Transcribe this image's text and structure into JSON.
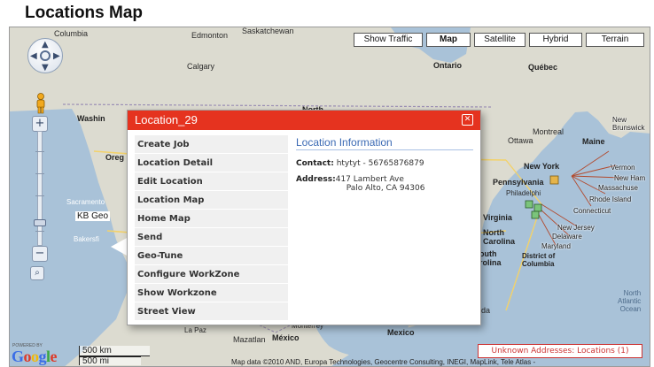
{
  "page": {
    "title": "Locations Map"
  },
  "map": {
    "buttons": {
      "traffic": "Show Traffic",
      "map": "Map",
      "satellite": "Satellite",
      "hybrid": "Hybrid",
      "terrain": "Terrain"
    },
    "labels": {
      "columbia": "Columbia",
      "edmonton": "Edmonton",
      "saskatchewan": "Saskatchewan",
      "calgary": "Calgary",
      "ontario": "Ontario",
      "quebec": "Québec",
      "washington": "Washin",
      "north": "North",
      "oregon": "Oreg",
      "new_brunswick": "New\nBrunswick",
      "maine": "Maine",
      "montreal": "Montreal",
      "ottawa": "Ottawa",
      "new_york": "New York",
      "vermont": "Vermon",
      "new_hampshire": "New Ham",
      "massachusetts": "Massachuse",
      "pennsylvania": "Pennsylvania",
      "philadelphia": "Philadelphi",
      "rhode_island": "Rhode Island",
      "connecticut": "Connecticut",
      "virginia": "Virginia",
      "new_jersey": "New Jersey",
      "delaware": "Delaware",
      "maryland": "Maryland",
      "north_carolina": "North\nCarolina",
      "south_carolina": "outh\nrolina",
      "dc": "District of\nColumbia",
      "ida": "ida",
      "atlantic": "North\nAtlantic\nOcean",
      "sacramento": "Sacramento",
      "kb_geo": "KB Geo",
      "bakersfield": "Bakersfi",
      "mazatlan": "Mazatlan",
      "mexico": "México",
      "mexico2": "Mexico",
      "monterrey": "Monterrey",
      "la_paz": "La Paz"
    },
    "scale": {
      "km": "500 km",
      "mi": "500 mi"
    },
    "logo": {
      "powered": "POWERED BY",
      "text": "Google"
    },
    "attribution": "Map data ©2010 AND, Europa Technologies, Geocentre Consulting, INEGI, MapLink, Tele Atlas -",
    "unknown_addresses": "Unknown Addresses: Locations (1)"
  },
  "popup": {
    "title": "Location_29",
    "close": "✕",
    "menu": [
      "Create Job",
      "Location Detail",
      "Edit Location",
      "Location Map",
      "Home Map",
      "Send",
      "Geo-Tune",
      "Configure WorkZone",
      "Show Workzone",
      "Street View"
    ],
    "info": {
      "heading": "Location Information",
      "contact_label": "Contact:",
      "contact_value": "htytyt - 56765876879",
      "address_label": "Address:",
      "address_line1": "417 Lambert Ave",
      "address_line2": "Palo Alto, CA 94306"
    }
  },
  "colors": {
    "header_red": "#e5331f",
    "info_blue": "#3b6ab4",
    "water": "#a9c2d8",
    "land": "#dcdbd0"
  },
  "icons": [
    "pan-control-icon",
    "pegman-icon",
    "zoom-in-icon",
    "zoom-out-icon",
    "magnify-icon",
    "close-icon",
    "location-marker-icon"
  ]
}
